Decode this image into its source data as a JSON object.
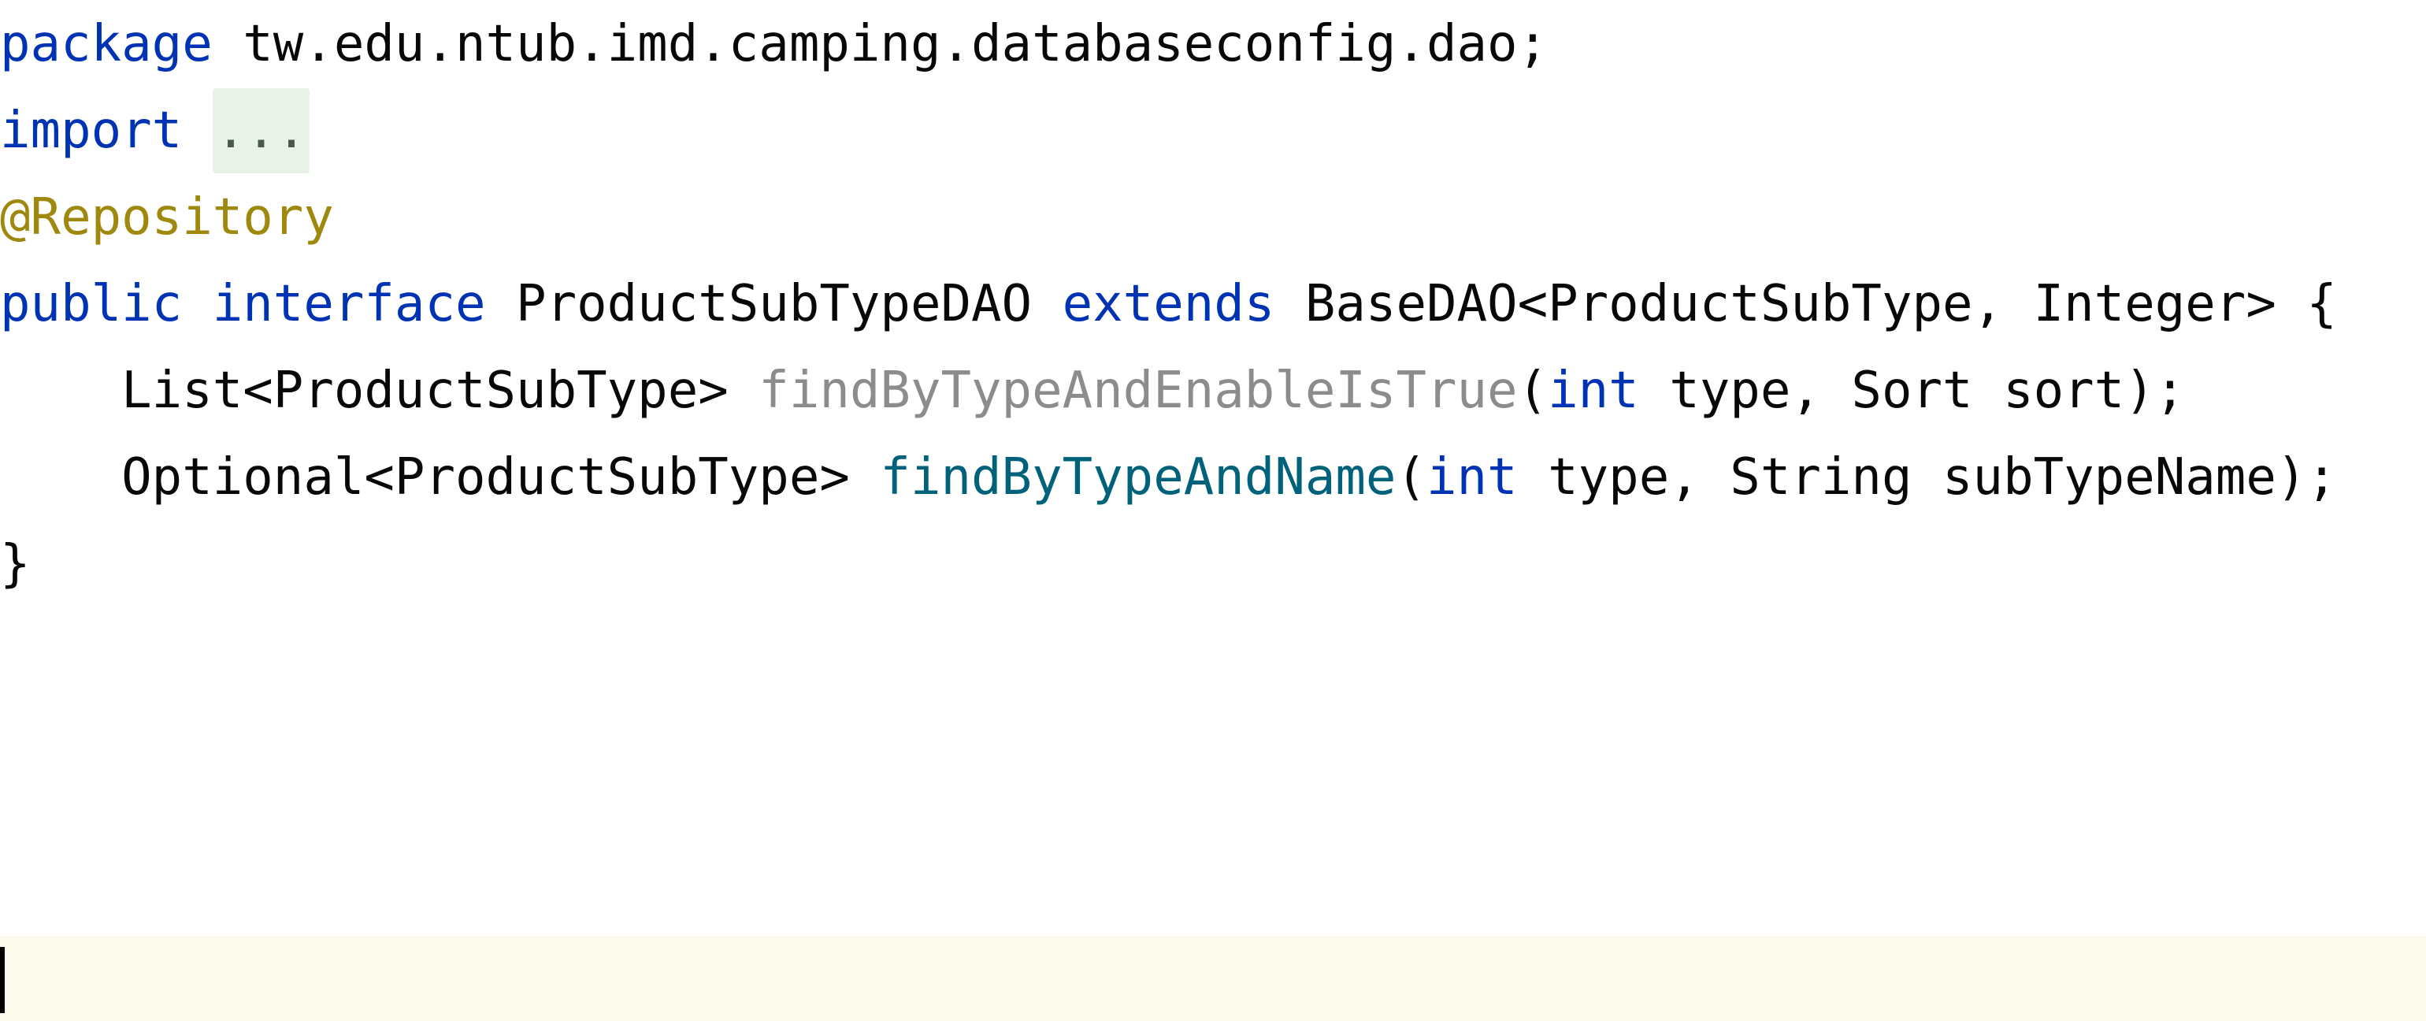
{
  "code": {
    "package_line": {
      "keyword": "package",
      "name": "tw.edu.ntub.imd.camping.databaseconfig.dao",
      "semicolon": ";"
    },
    "import_line": {
      "keyword": "import",
      "folded": "..."
    },
    "annotation": "@Repository",
    "declaration": {
      "kw_public": "public",
      "kw_interface": "interface",
      "name": "ProductSubTypeDAO",
      "kw_extends": "extends",
      "parent": "BaseDAO<ProductSubType, Integer>",
      "brace": "{"
    },
    "method1": {
      "indent": "    ",
      "return_type": "List<ProductSubType>",
      "name": "findByTypeAndEnableIsTrue",
      "open_paren": "(",
      "param_type_kw": "int",
      "params_rest": "type, Sort sort);"
    },
    "method2": {
      "indent": "    ",
      "return_type": "Optional<ProductSubType>",
      "name": "findByTypeAndName",
      "open_paren": "(",
      "param_type_kw": "int",
      "params_rest": "type, String subTypeName);"
    },
    "closing_brace": "}"
  },
  "colors": {
    "keyword": "#0033b3",
    "annotation": "#9e880d",
    "unused_method": "#8c8c8c",
    "method_declaration": "#00627a",
    "current_line_bg": "#fcfaed",
    "folded_bg": "#e8f2e6"
  }
}
